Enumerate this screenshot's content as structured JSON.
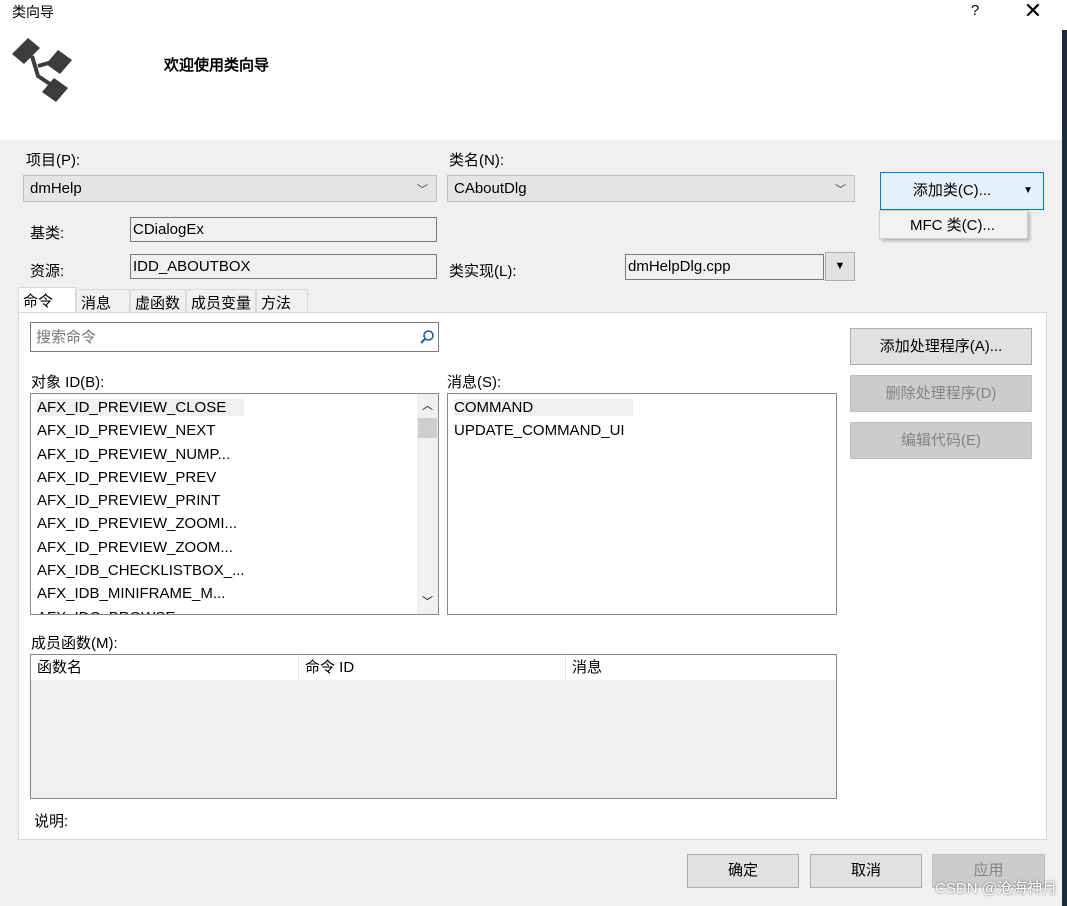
{
  "window": {
    "title": "类向导",
    "help": "?",
    "close": "✕"
  },
  "header": {
    "welcome": "欢迎使用类向导"
  },
  "project": {
    "label": "项目(P):",
    "value": "dmHelp"
  },
  "classname": {
    "label": "类名(N):",
    "value": "CAboutDlg"
  },
  "add_class": {
    "label": "添加类(C)...",
    "menu_item": "MFC 类(C)..."
  },
  "base_class": {
    "label": "基类:",
    "value": "CDialogEx"
  },
  "resource": {
    "label": "资源:",
    "value": "IDD_ABOUTBOX"
  },
  "class_impl": {
    "label": "类实现(L):",
    "value": "dmHelpDlg.cpp"
  },
  "tabs": [
    "命令",
    "消息",
    "虚函数",
    "成员变量",
    "方法"
  ],
  "search": {
    "placeholder": "搜索命令"
  },
  "object_ids": {
    "label": "对象 ID(B):",
    "items": [
      "AFX_ID_PREVIEW_CLOSE",
      "AFX_ID_PREVIEW_NEXT",
      "AFX_ID_PREVIEW_NUMP...",
      "AFX_ID_PREVIEW_PREV",
      "AFX_ID_PREVIEW_PRINT",
      "AFX_ID_PREVIEW_ZOOMI...",
      "AFX_ID_PREVIEW_ZOOM...",
      "AFX_IDB_CHECKLISTBOX_...",
      "AFX_IDB_MINIFRAME_M...",
      "AFX_IDC_BROWSE"
    ]
  },
  "messages": {
    "label": "消息(S):",
    "items": [
      "COMMAND",
      "UPDATE_COMMAND_UI"
    ]
  },
  "actions": {
    "add_handler": "添加处理程序(A)...",
    "delete_handler": "删除处理程序(D)",
    "edit_code": "编辑代码(E)"
  },
  "member_functions": {
    "label": "成员函数(M):",
    "columns": [
      "函数名",
      "命令 ID",
      "消息"
    ]
  },
  "description": {
    "label": "说明:"
  },
  "footer": {
    "ok": "确定",
    "cancel": "取消",
    "apply": "应用"
  },
  "watermark": "CSDN @沧海神月"
}
